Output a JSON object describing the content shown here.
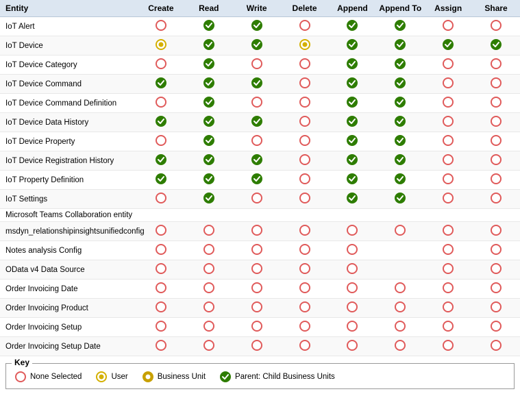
{
  "header": {
    "columns": [
      "Entity",
      "Create",
      "Read",
      "Write",
      "Delete",
      "Append",
      "Append To",
      "Assign",
      "Share"
    ]
  },
  "rows": [
    {
      "entity": "IoT Alert",
      "create": "none",
      "read": "parent",
      "write": "parent",
      "delete": "none",
      "append": "parent",
      "appendTo": "parent",
      "assign": "none",
      "share": "none"
    },
    {
      "entity": "IoT Device",
      "create": "user",
      "read": "parent",
      "write": "parent",
      "delete": "user",
      "append": "parent",
      "appendTo": "parent",
      "assign": "parent",
      "share": "parent"
    },
    {
      "entity": "IoT Device Category",
      "create": "none",
      "read": "parent",
      "write": "none",
      "delete": "none",
      "append": "parent",
      "appendTo": "parent",
      "assign": "none",
      "share": "none"
    },
    {
      "entity": "IoT Device Command",
      "create": "parent",
      "read": "parent",
      "write": "parent",
      "delete": "none",
      "append": "parent",
      "appendTo": "parent",
      "assign": "none",
      "share": "none"
    },
    {
      "entity": "IoT Device Command Definition",
      "create": "none",
      "read": "parent",
      "write": "none",
      "delete": "none",
      "append": "parent",
      "appendTo": "parent",
      "assign": "none",
      "share": "none"
    },
    {
      "entity": "IoT Device Data History",
      "create": "parent",
      "read": "parent",
      "write": "parent",
      "delete": "none",
      "append": "parent",
      "appendTo": "parent",
      "assign": "none",
      "share": "none"
    },
    {
      "entity": "IoT Device Property",
      "create": "none",
      "read": "parent",
      "write": "none",
      "delete": "none",
      "append": "parent",
      "appendTo": "parent",
      "assign": "none",
      "share": "none"
    },
    {
      "entity": "IoT Device Registration History",
      "create": "parent",
      "read": "parent",
      "write": "parent",
      "delete": "none",
      "append": "parent",
      "appendTo": "parent",
      "assign": "none",
      "share": "none"
    },
    {
      "entity": "IoT Property Definition",
      "create": "parent",
      "read": "parent",
      "write": "parent",
      "delete": "none",
      "append": "parent",
      "appendTo": "parent",
      "assign": "none",
      "share": "none"
    },
    {
      "entity": "IoT Settings",
      "create": "none",
      "read": "parent",
      "write": "none",
      "delete": "none",
      "append": "parent",
      "appendTo": "parent",
      "assign": "none",
      "share": "none"
    },
    {
      "entity": "Microsoft Teams Collaboration entity",
      "create": "",
      "read": "",
      "write": "",
      "delete": "",
      "append": "",
      "appendTo": "",
      "assign": "",
      "share": ""
    },
    {
      "entity": "msdyn_relationshipinsightsunifiedconfig",
      "create": "none",
      "read": "none",
      "write": "none",
      "delete": "none",
      "append": "none",
      "appendTo": "none",
      "assign": "none",
      "share": "none"
    },
    {
      "entity": "Notes analysis Config",
      "create": "none",
      "read": "none",
      "write": "none",
      "delete": "none",
      "append": "none",
      "appendTo": "",
      "assign": "none",
      "share": "none"
    },
    {
      "entity": "OData v4 Data Source",
      "create": "none",
      "read": "none",
      "write": "none",
      "delete": "none",
      "append": "none",
      "appendTo": "",
      "assign": "none",
      "share": "none"
    },
    {
      "entity": "Order Invoicing Date",
      "create": "none",
      "read": "none",
      "write": "none",
      "delete": "none",
      "append": "none",
      "appendTo": "none",
      "assign": "none",
      "share": "none"
    },
    {
      "entity": "Order Invoicing Product",
      "create": "none",
      "read": "none",
      "write": "none",
      "delete": "none",
      "append": "none",
      "appendTo": "none",
      "assign": "none",
      "share": "none"
    },
    {
      "entity": "Order Invoicing Setup",
      "create": "none",
      "read": "none",
      "write": "none",
      "delete": "none",
      "append": "none",
      "appendTo": "none",
      "assign": "none",
      "share": "none"
    },
    {
      "entity": "Order Invoicing Setup Date",
      "create": "none",
      "read": "none",
      "write": "none",
      "delete": "none",
      "append": "none",
      "appendTo": "none",
      "assign": "none",
      "share": "none"
    }
  ],
  "key": {
    "title": "Key",
    "items": [
      {
        "label": "None Selected",
        "type": "none"
      },
      {
        "label": "User",
        "type": "user"
      },
      {
        "label": "Business Unit",
        "type": "bu"
      },
      {
        "label": "Parent: Child Business Units",
        "type": "parent"
      }
    ]
  }
}
